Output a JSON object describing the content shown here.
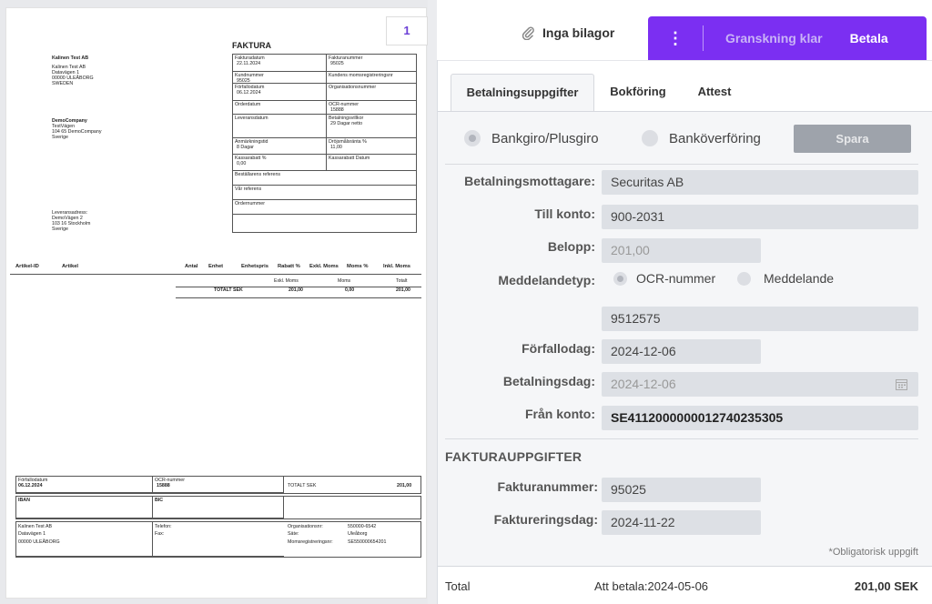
{
  "preview": {
    "page_number": "1",
    "doc_title": "FAKTURA",
    "seller": {
      "name": "Kalinen Test AB",
      "line1": "Kalinen Test AB",
      "line2": "Datavägen 1",
      "line3": "00000 ULEÅBORG",
      "line4": "SWEDEN"
    },
    "buyer": {
      "name": "DemoCompany",
      "line1": "TestVägen",
      "line2": "104 65 DemoCompany",
      "line3": "Sverige"
    },
    "delivery": {
      "label": "Leveransadress:",
      "line1": "DemoVägen 2",
      "line2": "103 16 Stockholm",
      "line3": "Sverige"
    },
    "header_grid": [
      {
        "l_label": "Fakturadatum",
        "l_value": "22.11.2024",
        "r_label": "Fakturanummer",
        "r_value": "95025"
      },
      {
        "l_label": "Kundnummer",
        "l_value": "95025",
        "r_label": "Kundens momsregistreringsnr",
        "r_value": ""
      },
      {
        "l_label": "Förfallodatum",
        "l_value": "06.12.2024",
        "r_label": "Organisationsnummer",
        "r_value": ""
      },
      {
        "l_label": "Orderdatum",
        "l_value": "",
        "r_label": "OCR-nummer",
        "r_value": "15888"
      },
      {
        "l_label": "Leveransdatum",
        "l_value": "",
        "r_label": "Betalningsvillkor",
        "r_value": "29 Dagar netto"
      },
      {
        "l_label": "Anmärkningstid",
        "l_value": "8 Dagar",
        "r_label": "Dröjsmålsränta %",
        "r_value": "11,00"
      },
      {
        "l_label": "Kassarabatt %",
        "l_value": "0,00",
        "r_label": "Kassarabatt Datum",
        "r_value": ""
      }
    ],
    "ref_rows": [
      "Beställarens referens",
      "Vår referens",
      "Ordernummer"
    ],
    "article_headers": [
      "Artikel-ID",
      "Artikel",
      "Antal",
      "Enhet",
      "Enhetspris",
      "Rabatt %",
      "Exkl. Moms",
      "Moms %",
      "Inkl. Moms"
    ],
    "summary": {
      "headers": [
        "Exkl. Moms",
        "Moms",
        "Totalt"
      ],
      "label": "TOTALT SEK",
      "values": [
        "201,00",
        "0,00",
        "201,00"
      ]
    },
    "bottom": {
      "due_label": "Förfallodatum",
      "due_value": "06.12.2024",
      "ocr_label": "OCR-nummer",
      "ocr_value": "15888",
      "total_label": "TOTALT SEK",
      "total_value": "201,00",
      "iban_label": "IBAN",
      "bic_label": "BIC",
      "company": "Kalinen Test AB",
      "street": "Datavägen 1",
      "city": "00000 ULEÅBORG",
      "phone_label": "Telefon:",
      "fax_label": "Fax:",
      "org_label": "Organisationsnr:",
      "org_value": "550000-6542",
      "seat_label": "Säte:",
      "seat_value": "Uleåborg",
      "vat_label": "Momsregistreringsnr:",
      "vat_value": "SE550000654201"
    }
  },
  "topbar": {
    "attachments_label": "Inga bilagor",
    "menu_dots": "⋮",
    "review_label": "Granskning klar",
    "pay_label": "Betala",
    "accent": "#7b2ff2"
  },
  "tabs": [
    {
      "label": "Betalningsuppgifter",
      "active": true
    },
    {
      "label": "Bokföring",
      "active": false
    },
    {
      "label": "Attest",
      "active": false
    }
  ],
  "payment_form": {
    "method_options": [
      {
        "label": "Bankgiro/Plusgiro",
        "selected": true
      },
      {
        "label": "Banköverföring",
        "selected": false
      }
    ],
    "save_label": "Spara",
    "recipient_label": "Betalningsmottagare:",
    "recipient_value": "Securitas AB",
    "to_account_label": "Till konto:",
    "to_account_value": "900-2031",
    "amount_label": "Belopp:",
    "amount_value": "201,00",
    "message_type_label": "Meddelandetyp:",
    "message_types": [
      {
        "label": "OCR-nummer",
        "selected": true
      },
      {
        "label": "Meddelande",
        "selected": false
      }
    ],
    "ocr_value": "9512575",
    "due_date_label": "Förfallodag:",
    "due_date_value": "2024-12-06",
    "payment_date_label": "Betalningsdag:",
    "payment_date_value": "2024-12-06",
    "from_account_label": "Från konto:",
    "from_account_value": "SE4112000000012740235305"
  },
  "invoice_section": {
    "title": "FAKTURAUPPGIFTER",
    "invoice_number_label": "Fakturanummer:",
    "invoice_number_value": "95025",
    "invoice_date_label": "Faktureringsdag:",
    "invoice_date_value": "2024-11-22",
    "required_note": "*Obligatorisk uppgift"
  },
  "footer": {
    "total_label": "Total",
    "to_pay": "Att betala:2024-05-06",
    "amount": "201,00 SEK"
  }
}
